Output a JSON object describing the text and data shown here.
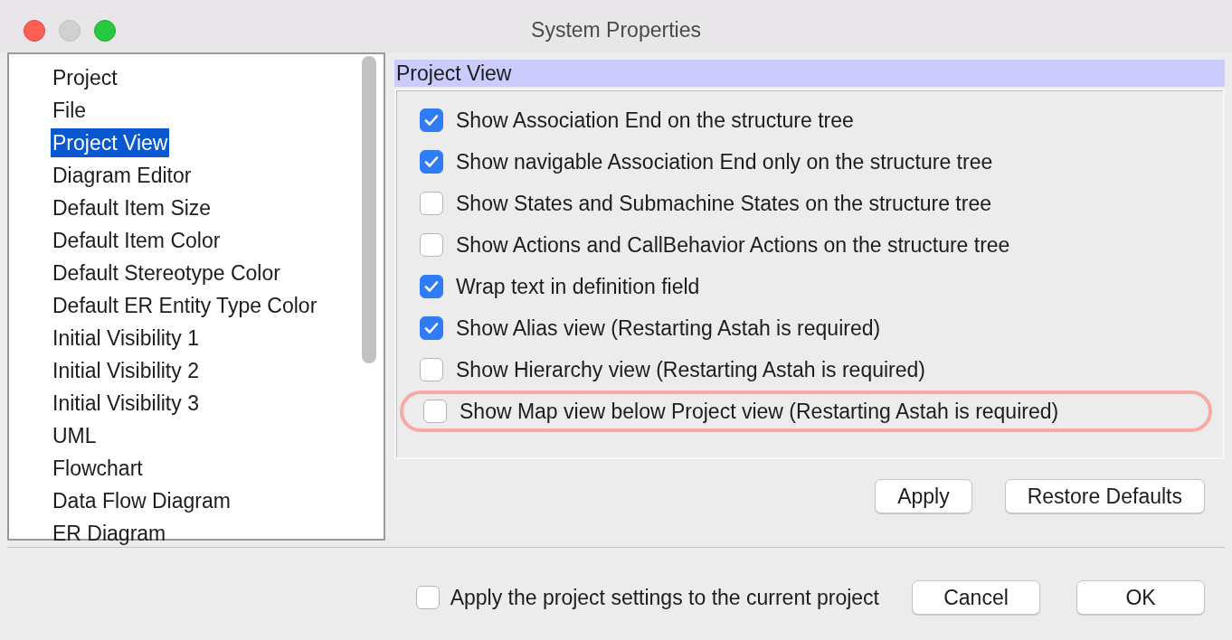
{
  "window": {
    "title": "System Properties"
  },
  "sidebar": {
    "items": [
      {
        "label": "Project",
        "selected": false
      },
      {
        "label": "File",
        "selected": false
      },
      {
        "label": "Project View",
        "selected": true
      },
      {
        "label": "Diagram Editor",
        "selected": false
      },
      {
        "label": "Default Item Size",
        "selected": false
      },
      {
        "label": "Default Item Color",
        "selected": false
      },
      {
        "label": "Default Stereotype Color",
        "selected": false
      },
      {
        "label": "Default ER Entity Type Color",
        "selected": false
      },
      {
        "label": "Initial Visibility 1",
        "selected": false
      },
      {
        "label": "Initial Visibility 2",
        "selected": false
      },
      {
        "label": "Initial Visibility 3",
        "selected": false
      },
      {
        "label": "UML",
        "selected": false
      },
      {
        "label": "Flowchart",
        "selected": false
      },
      {
        "label": "Data Flow Diagram",
        "selected": false
      },
      {
        "label": "ER Diagram",
        "selected": false
      }
    ]
  },
  "panel": {
    "title": "Project View",
    "options": [
      {
        "label": "Show Association End on the structure tree",
        "checked": true,
        "highlighted": false
      },
      {
        "label": "Show navigable Association End only on the structure tree",
        "checked": true,
        "highlighted": false
      },
      {
        "label": "Show States and Submachine States on the structure tree",
        "checked": false,
        "highlighted": false
      },
      {
        "label": "Show Actions and CallBehavior Actions on the structure tree",
        "checked": false,
        "highlighted": false
      },
      {
        "label": "Wrap text in definition field",
        "checked": true,
        "highlighted": false
      },
      {
        "label": "Show Alias view (Restarting Astah is required)",
        "checked": true,
        "highlighted": false
      },
      {
        "label": "Show Hierarchy view (Restarting Astah is required)",
        "checked": false,
        "highlighted": false
      },
      {
        "label": "Show Map view below Project view (Restarting Astah is required)",
        "checked": false,
        "highlighted": true
      }
    ],
    "buttons": [
      "Apply",
      "Restore Defaults"
    ]
  },
  "footer": {
    "apply_to_project": {
      "label": "Apply the project settings to the current project",
      "checked": false
    },
    "buttons": [
      "Cancel",
      "OK"
    ]
  }
}
